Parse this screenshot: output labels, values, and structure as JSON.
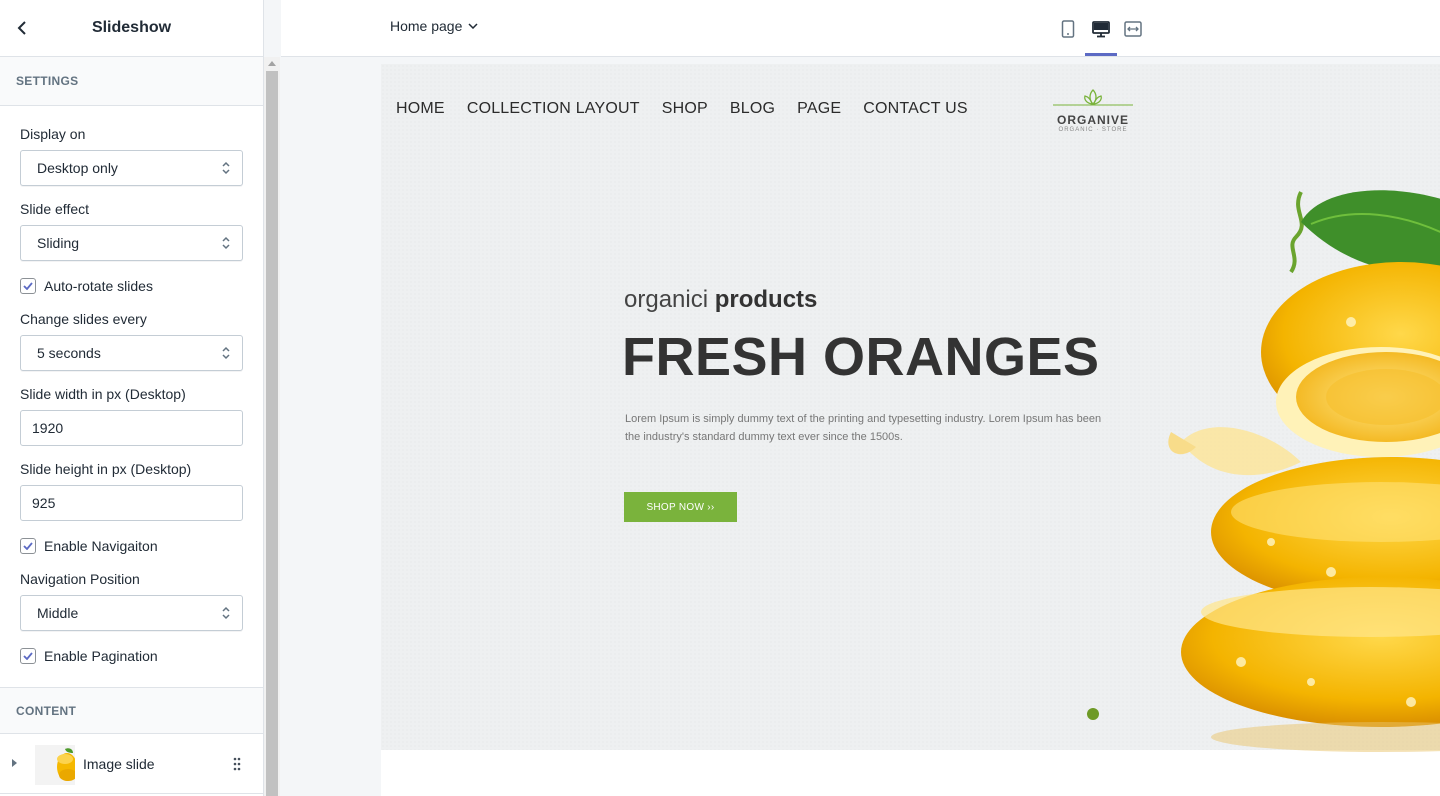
{
  "sidebar": {
    "title": "Slideshow",
    "settings_header": "SETTINGS",
    "display_on": {
      "label": "Display on",
      "value": "Desktop only"
    },
    "slide_effect": {
      "label": "Slide effect",
      "value": "Sliding"
    },
    "auto_rotate": {
      "label": "Auto-rotate slides",
      "checked": true
    },
    "change_every": {
      "label": "Change slides every",
      "value": "5 seconds"
    },
    "slide_width": {
      "label": "Slide width in px (Desktop)",
      "value": "1920"
    },
    "slide_height": {
      "label": "Slide height in px (Desktop)",
      "value": "925"
    },
    "enable_nav": {
      "label": "Enable Navigaiton",
      "checked": true
    },
    "nav_position": {
      "label": "Navigation Position",
      "value": "Middle"
    },
    "enable_pagination": {
      "label": "Enable Pagination",
      "checked": true
    },
    "content_header": "CONTENT",
    "content_items": [
      {
        "label": "Image slide"
      }
    ]
  },
  "topbar": {
    "page_select": "Home page",
    "devices": [
      "mobile-icon",
      "desktop-icon",
      "fullwidth-icon"
    ],
    "active_device": "desktop-icon",
    "accent": "#5c6ac4"
  },
  "preview": {
    "nav": [
      "HOME",
      "COLLECTION LAYOUT",
      "SHOP",
      "BLOG",
      "PAGE",
      "CONTACT US"
    ],
    "logo_name": "ORGANIVE",
    "logo_sub": "ORGANIC · STORE",
    "headline_light": "organici",
    "headline_bold": "products",
    "headline_big": "FRESH ORANGES",
    "description": "Lorem Ipsum is simply dummy text of the printing and typesetting industry. Lorem Ipsum has been the industry's standard dummy text ever since the 1500s.",
    "button": "SHOP NOW ››",
    "button_color": "#7ab33c"
  }
}
